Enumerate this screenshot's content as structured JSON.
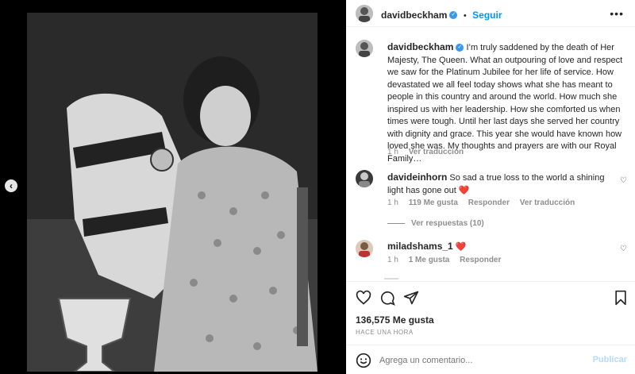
{
  "photo": {
    "description_icon": "image-photo-icon"
  },
  "header": {
    "username": "davidbeckham",
    "follow_label": "Seguir",
    "more_icon": "more-icon"
  },
  "caption": {
    "username": "davidbeckham",
    "text": "I’m truly saddened by the death of Her Majesty, The Queen. What an outpouring of love and respect we saw for the Platinum Jubilee for her life of service. How devastated we all feel today shows what she has meant to people in this country and around the world. How much she inspired us with her leadership. How she comforted us when times were tough. Until her last days she served her country with dignity and grace. This year she would have known how loved she was. My thoughts and prayers are with our Royal Family…",
    "time": "1 h",
    "translate": "Ver traducción"
  },
  "comments": [
    {
      "username": "davideinhorn",
      "text": "So sad a true loss to the world a shining light has gone out ❤️",
      "time": "1 h",
      "likes": "119 Me gusta",
      "reply": "Responder",
      "translate": "Ver traducción",
      "replies_label": "Ver respuestas (10)"
    },
    {
      "username": "miladshams_1",
      "text": "❤️",
      "time": "1 h",
      "likes": "1 Me gusta",
      "reply": "Responder"
    }
  ],
  "likes": "136,575 Me gusta",
  "posted": "HACE UNA HORA",
  "comment_box": {
    "placeholder": "Agrega un comentario...",
    "post_label": "Publicar"
  },
  "colors": {
    "accent": "#0095f6",
    "verified": "#3897f0",
    "heart_red": "#ed4956"
  }
}
